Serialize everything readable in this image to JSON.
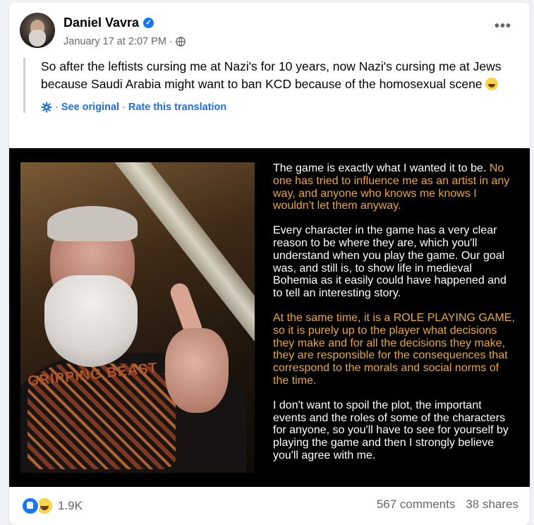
{
  "post": {
    "author": "Daniel Vavra",
    "timestamp": "January 17 at 2:07 PM",
    "separator": "·",
    "text": "So after the leftists cursing me at Nazi's for 10 years, now Nazi's cursing me at Jews because Saudi Arabia might want to ban KCD because of the homosexual scene",
    "see_original": "See original",
    "rate_translation": "Rate this translation",
    "dot": "·"
  },
  "image_text": {
    "p1_white": "The game is exactly what I wanted it to be.",
    "p1_orange": "No one has tried to influence me as an artist in any way, and anyone who knows me knows I wouldn't let them anyway.",
    "p2": "Every character in the game has a very clear reason to be where they are, which you'll understand when you play the game. Our goal was, and still is, to show life in medieval Bohemia as it easily could have happened and to tell an interesting story.",
    "p3": "At the same time, it is a ROLE PLAYING GAME, so it is purely up to the player what decisions they make and for all the decisions they make, they are responsible for the consequences that correspond to the morals and social norms of the time.",
    "p4": "I don't want to spoil the plot, the important events and the roles of some of the characters for anyone, so you'll have to see for yourself by playing the game and then I strongly believe you'll agree with me.",
    "shirt_print": "GRIPPING BEAST"
  },
  "footer": {
    "reaction_count": "1.9K",
    "comments": "567 comments",
    "shares": "38 shares"
  },
  "colors": {
    "accent_blue": "#1877f2",
    "link_blue": "#216fdb",
    "image_orange": "#e9a73b"
  }
}
